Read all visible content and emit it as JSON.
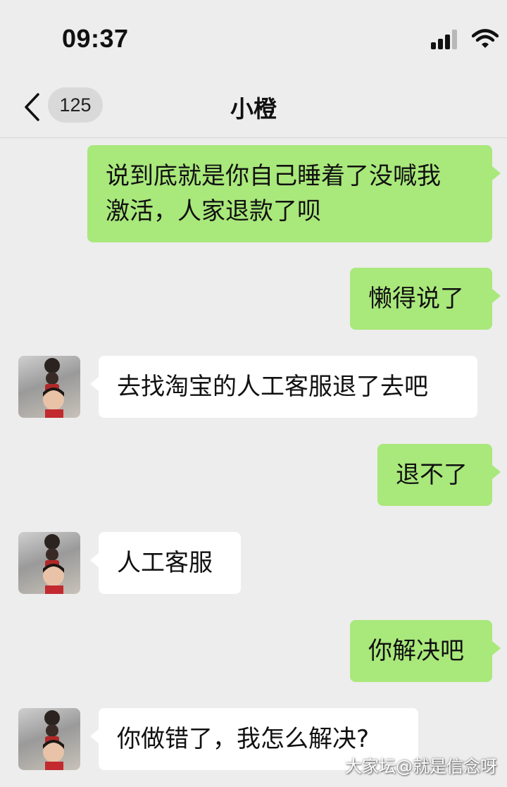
{
  "status_bar": {
    "time": "09:37",
    "signal_icon": "signal-icon",
    "wifi_icon": "wifi-icon"
  },
  "nav": {
    "back_icon": "chevron-left-icon",
    "unread_count": "125",
    "title": "小橙"
  },
  "messages": [
    {
      "from": "me",
      "text": "说到底就是你自己睡着了没喊我\n激活，人家退款了呗"
    },
    {
      "from": "me",
      "text": "懒得说了"
    },
    {
      "from": "other",
      "text": "去找淘宝的人工客服退了去吧"
    },
    {
      "from": "me",
      "text": "退不了"
    },
    {
      "from": "other",
      "text": "人工客服"
    },
    {
      "from": "me",
      "text": "你解决吧"
    },
    {
      "from": "other",
      "text": "你做错了，我怎么解决?"
    }
  ],
  "watermark": "大家坛@就是信念呀",
  "colors": {
    "background": "#ededed",
    "my_bubble": "#a9e87b",
    "other_bubble": "#ffffff"
  }
}
